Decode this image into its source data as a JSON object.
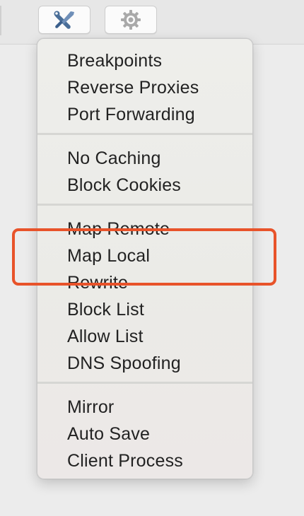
{
  "toolbar": {
    "buttons": [
      {
        "icon": "tools-icon"
      },
      {
        "icon": "gear-icon"
      }
    ]
  },
  "menu": {
    "sections": [
      {
        "items": [
          "Breakpoints",
          "Reverse Proxies",
          "Port Forwarding"
        ]
      },
      {
        "items": [
          "No Caching",
          "Block Cookies"
        ]
      },
      {
        "items": [
          "Map Remote",
          "Map Local",
          "Rewrite",
          "Block List",
          "Allow List",
          "DNS Spoofing"
        ]
      },
      {
        "items": [
          "Mirror",
          "Auto Save",
          "Client Process"
        ]
      }
    ]
  },
  "annotation": {
    "highlighted_item": "Map Local",
    "color": "#e8532a"
  },
  "colors": {
    "menu_background": "#ebebe7",
    "text": "#222222",
    "highlight": "#e8532a"
  }
}
